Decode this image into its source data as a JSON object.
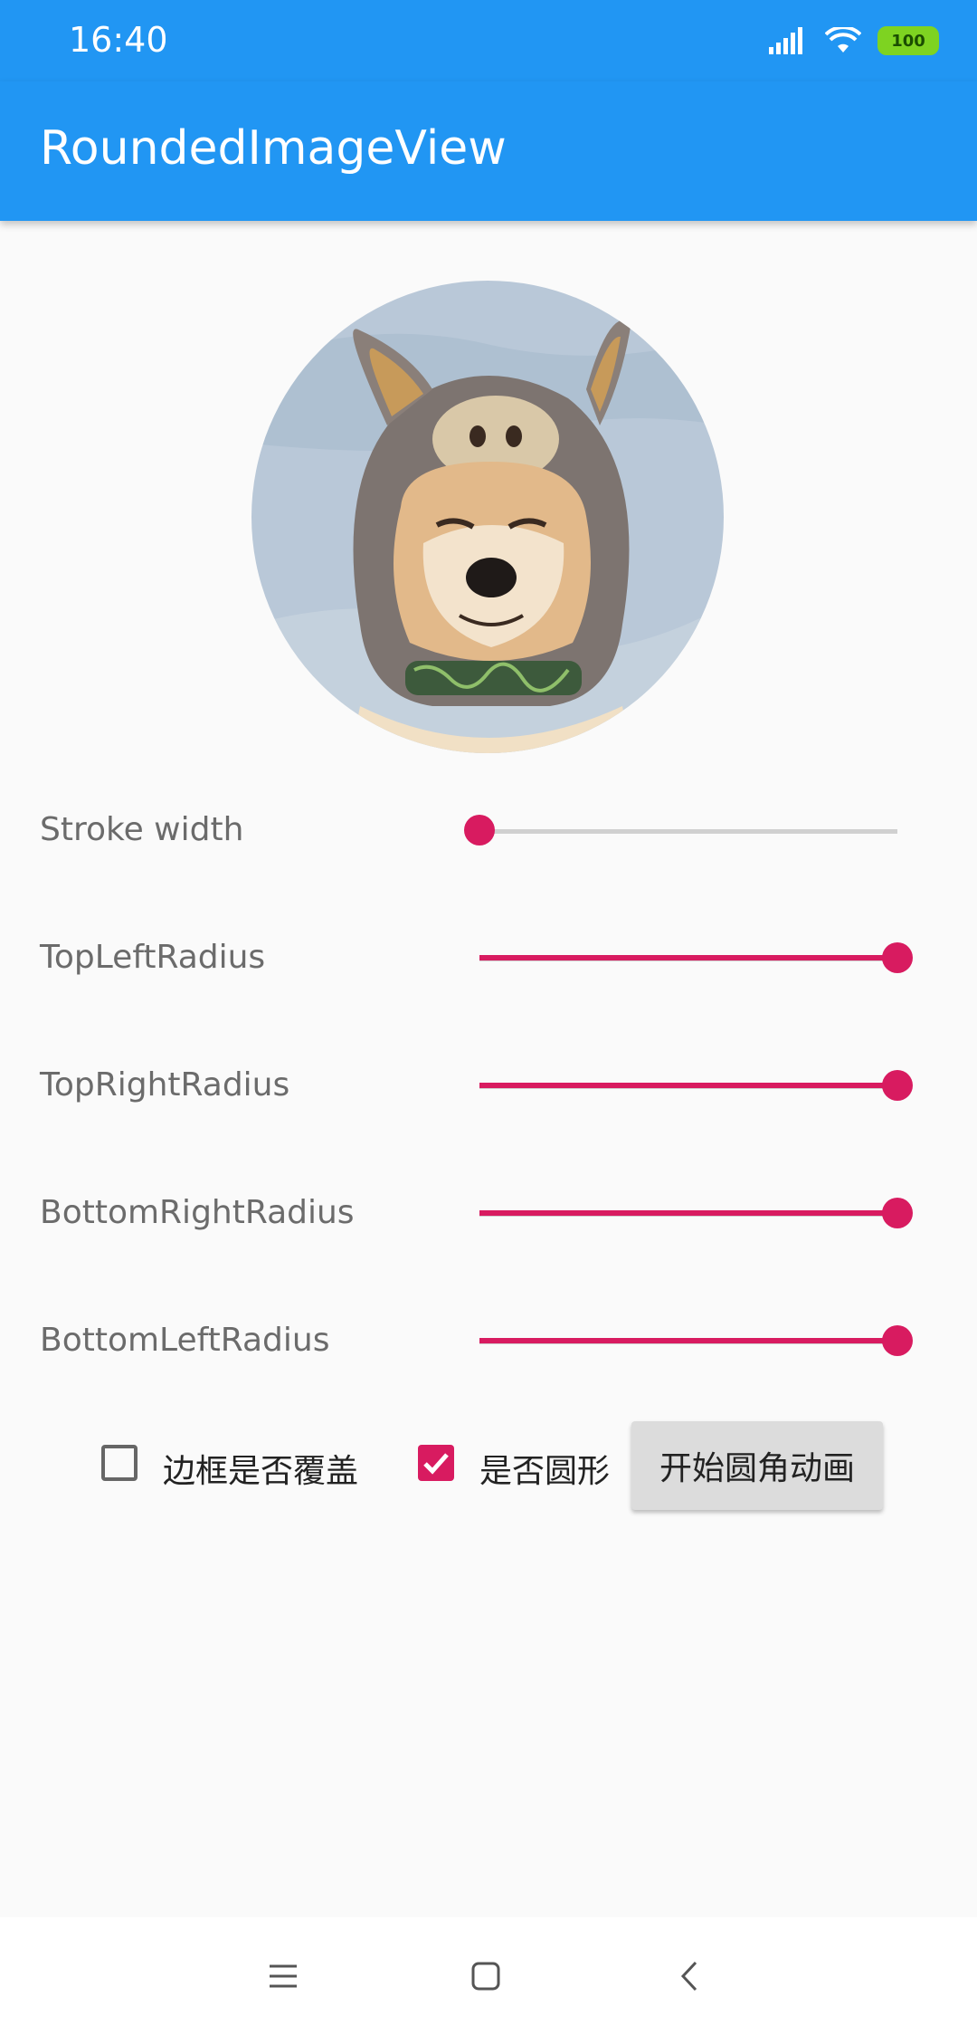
{
  "status_bar": {
    "time": "16:40",
    "battery_level": "100",
    "icons": [
      "signal-icon",
      "wifi-icon",
      "battery-icon"
    ]
  },
  "app_bar": {
    "title": "RoundedImageView"
  },
  "image": {
    "description_icon": "dog-photo"
  },
  "sliders": [
    {
      "label": "Stroke width",
      "value": 0.0
    },
    {
      "label": "TopLeftRadius",
      "value": 1.0
    },
    {
      "label": "TopRightRadius",
      "value": 1.0
    },
    {
      "label": "BottomRightRadius",
      "value": 1.0
    },
    {
      "label": "BottomLeftRadius",
      "value": 1.0
    }
  ],
  "controls": {
    "border_overlay": {
      "label": "边框是否覆盖",
      "checked": false
    },
    "is_oval": {
      "label": "是否圆形",
      "checked": true
    },
    "animate_button": "开始圆角动画"
  },
  "colors": {
    "primary": "#2196f3",
    "accent": "#d81b60",
    "background": "#fafafa"
  },
  "nav_bar": {
    "icons": [
      "menu-icon",
      "home-icon",
      "back-icon"
    ]
  }
}
